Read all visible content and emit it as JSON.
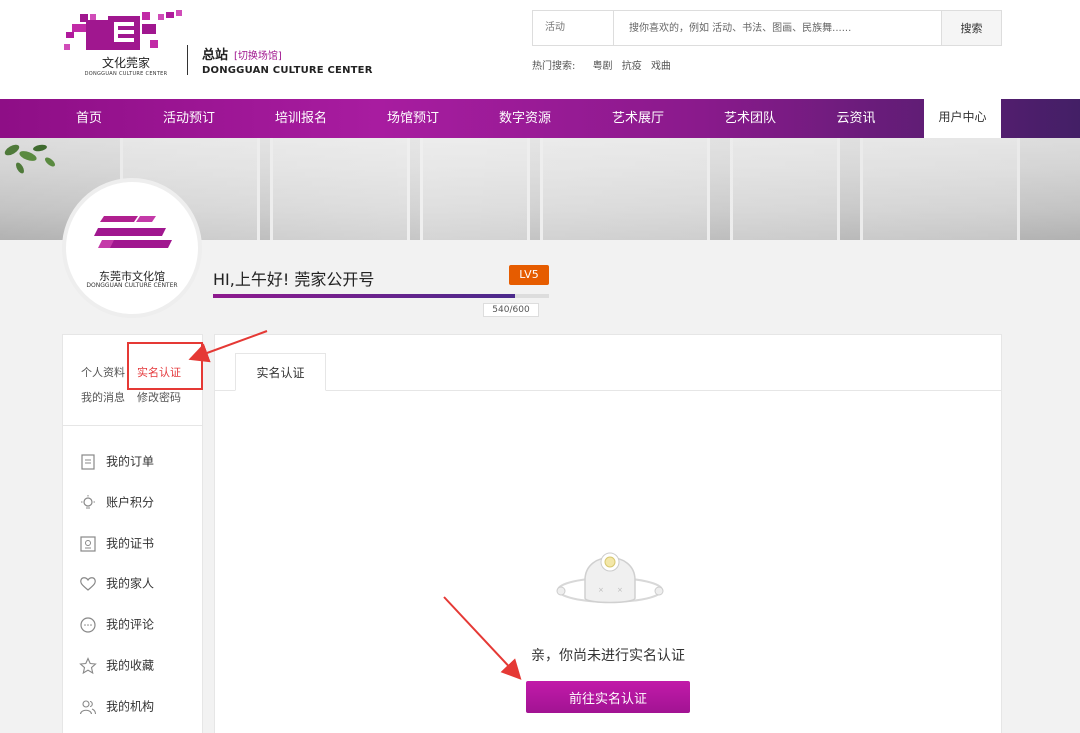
{
  "header": {
    "logo_cn": "文化莞家",
    "logo_en": "DONGGUAN CULTURE CENTER",
    "site_title": "总站",
    "switch_link": "[切换场馆]",
    "site_en": "DONGGUAN CULTURE CENTER",
    "search": {
      "category": "活动",
      "placeholder": "搜你喜欢的，例如 活动、书法、图画、民族舞......",
      "button": "搜索"
    },
    "hot_search": {
      "label": "热门搜索:",
      "terms": [
        "粤剧",
        "抗疫",
        "戏曲"
      ]
    }
  },
  "nav": {
    "items": [
      "首页",
      "活动预订",
      "培训报名",
      "场馆预订",
      "数字资源",
      "艺术展厅",
      "艺术团队",
      "云资讯",
      "用户中心"
    ],
    "active": "用户中心"
  },
  "profile": {
    "avatar_name": "东莞市文化馆",
    "avatar_en": "DONGGUAN CULTURE CENTER",
    "greeting": "HI,上午好!  莞家公开号",
    "level": "LV5",
    "points_current": 540,
    "points_max": 600,
    "points_text": "540/600"
  },
  "sidebar": {
    "quick_links": [
      [
        "个人资料",
        "实名认证"
      ],
      [
        "我的消息",
        "修改密码"
      ]
    ],
    "active_link": "实名认证",
    "items": [
      {
        "label": "我的订单",
        "icon": "order-icon"
      },
      {
        "label": "账户积分",
        "icon": "bulb-icon"
      },
      {
        "label": "我的证书",
        "icon": "certificate-icon"
      },
      {
        "label": "我的家人",
        "icon": "heart-icon"
      },
      {
        "label": "我的评论",
        "icon": "comment-icon"
      },
      {
        "label": "我的收藏",
        "icon": "star-icon"
      },
      {
        "label": "我的机构",
        "icon": "people-icon"
      }
    ]
  },
  "main": {
    "tab": "实名认证",
    "empty_message": "亲，你尚未进行实名认证",
    "action_button": "前往实名认证"
  },
  "colors": {
    "brand": "#a0178f",
    "badge": "#e65c00",
    "annotation": "#e53935"
  }
}
